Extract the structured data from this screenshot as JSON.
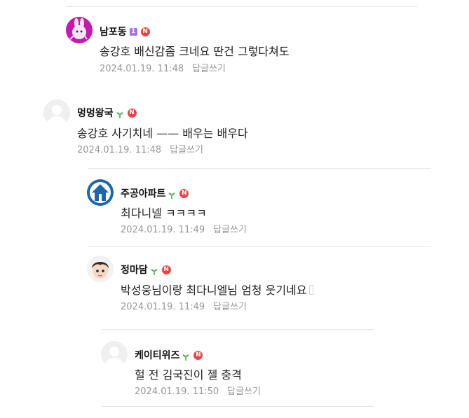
{
  "comments": [
    {
      "nickname": "남포동",
      "level_badge": "1",
      "badge_type": "level",
      "new_badge": "N",
      "text": "송강호 배신감좀 크네요 딴건 그렇다쳐도",
      "date": "2024.01.19. 11:48",
      "reply_label": "답글쓰기",
      "avatar_icon": "pink-bunny-avatar-icon"
    },
    {
      "nickname": "멍멍왕국",
      "badge_type": "sprout",
      "new_badge": "N",
      "text": "송강호 사기치네 —— 배우는 배우다",
      "date": "2024.01.19. 11:48",
      "reply_label": "답글쓰기",
      "avatar_icon": "default-user-avatar-icon"
    },
    {
      "nickname": "주공아파트",
      "badge_type": "sprout",
      "new_badge": "N",
      "text": "최다니넬 ㅋㅋㅋㅋ",
      "date": "2024.01.19. 11:49",
      "reply_label": "답글쓰기",
      "avatar_icon": "blue-house-logo-avatar-icon"
    },
    {
      "nickname": "정마담",
      "badge_type": "sprout",
      "new_badge": "N",
      "text": "박성웅님이랑 최다니엘님 엄청 웃기네요",
      "date": "2024.01.19. 11:49",
      "reply_label": "답글쓰기",
      "avatar_icon": "cartoon-face-avatar-icon"
    },
    {
      "nickname": "케이티위즈",
      "badge_type": "sprout",
      "new_badge": "N",
      "text": "헐 전 김국진이 젤 충격",
      "date": "2024.01.19. 11:50",
      "reply_label": "답글쓰기",
      "avatar_icon": "default-user-avatar-icon"
    }
  ],
  "colors": {
    "new_badge": "#e64545",
    "sprout": "#4caf50",
    "level_badge": "#a86ef0",
    "meta_text": "#979797"
  }
}
